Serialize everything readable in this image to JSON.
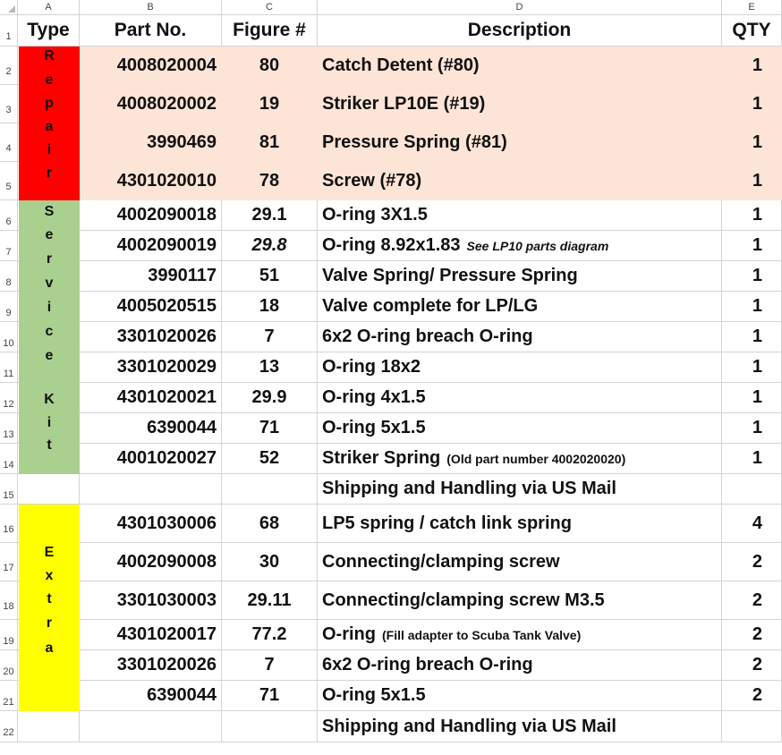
{
  "columns": [
    "A",
    "B",
    "C",
    "D",
    "E"
  ],
  "colors": {
    "repair": "#ff0000",
    "service_kit": "#a9d08e",
    "extra": "#ffff00",
    "repair_rows": "#fce4d6"
  },
  "headers": {
    "type": "Type",
    "part": "Part No.",
    "figure": "Figure #",
    "description": "Description",
    "qty": "QTY"
  },
  "groups": [
    {
      "label": "Repair",
      "chars": [
        "R",
        "e",
        "p",
        "a",
        "i",
        "r"
      ],
      "rows": [
        2,
        5
      ],
      "color_key": "repair"
    },
    {
      "label": "Service Kit",
      "chars": [
        "S",
        "e",
        "r",
        "v",
        "i",
        "c",
        "e",
        "",
        "K",
        "i",
        "t"
      ],
      "rows": [
        6,
        14
      ],
      "color_key": "service_kit"
    },
    {
      "label": "Extra",
      "chars": [
        "E",
        "x",
        "t",
        "r",
        "a"
      ],
      "rows": [
        16,
        21
      ],
      "color_key": "extra"
    }
  ],
  "rows": [
    {
      "num": "1"
    },
    {
      "num": "2",
      "part": "4008020004",
      "figure": "80",
      "description": "Catch Detent (#80)",
      "qty": "1"
    },
    {
      "num": "3",
      "part": "4008020002",
      "figure": "19",
      "description": "Striker LP10E (#19)",
      "qty": "1"
    },
    {
      "num": "4",
      "part": "3990469",
      "figure": "81",
      "description": "Pressure Spring (#81)",
      "qty": "1"
    },
    {
      "num": "5",
      "part": "4301020010",
      "figure": "78",
      "description": "Screw (#78)",
      "qty": "1"
    },
    {
      "num": "6",
      "part": "4002090018",
      "figure": "29.1",
      "description": "O-ring 3X1.5",
      "qty": "1"
    },
    {
      "num": "7",
      "part": "4002090019",
      "figure": "29.8",
      "description": "O-ring 8.92x1.83",
      "note": "See LP10 parts diagram",
      "qty": "1"
    },
    {
      "num": "8",
      "part": "3990117",
      "figure": "51",
      "description": "Valve Spring/ Pressure Spring",
      "qty": "1"
    },
    {
      "num": "9",
      "part": "4005020515",
      "figure": "18",
      "description": "Valve complete for LP/LG",
      "qty": "1"
    },
    {
      "num": "10",
      "part": "3301020026",
      "figure": "7",
      "description": "6x2  O-ring breach O-ring",
      "qty": "1"
    },
    {
      "num": "11",
      "part": "3301020029",
      "figure": "13",
      "description": "O-ring 18x2",
      "qty": "1"
    },
    {
      "num": "12",
      "part": "4301020021",
      "figure": "29.9",
      "description": "O-ring 4x1.5",
      "qty": "1"
    },
    {
      "num": "13",
      "part": "6390044",
      "figure": "71",
      "description": "O-ring 5x1.5",
      "qty": "1"
    },
    {
      "num": "14",
      "part": "4001020027",
      "figure": "52",
      "description": "Striker Spring",
      "note": "(Old part number 4002020020)",
      "qty": "1"
    },
    {
      "num": "15",
      "part": "",
      "figure": "",
      "description": "Shipping and Handling via US Mail",
      "qty": ""
    },
    {
      "num": "16",
      "part": "4301030006",
      "figure": "68",
      "description": "LP5 spring / catch link spring",
      "qty": "4"
    },
    {
      "num": "17",
      "part": "4002090008",
      "figure": "30",
      "description": "Connecting/clamping screw",
      "qty": "2"
    },
    {
      "num": "18",
      "part": "3301030003",
      "figure": "29.11",
      "description": "Connecting/clamping screw M3.5",
      "qty": "2"
    },
    {
      "num": "19",
      "part": "4301020017",
      "figure": "77.2",
      "description": "O-ring",
      "note": "(Fill adapter to Scuba Tank Valve)",
      "qty": "2"
    },
    {
      "num": "20",
      "part": "3301020026",
      "figure": "7",
      "description": "6x2  O-ring breach O-ring",
      "qty": "2"
    },
    {
      "num": "21",
      "part": "6390044",
      "figure": "71",
      "description": "O-ring 5x1.5",
      "qty": "2"
    },
    {
      "num": "22",
      "part": "",
      "figure": "",
      "description": "Shipping and Handling via US Mail",
      "qty": ""
    }
  ]
}
